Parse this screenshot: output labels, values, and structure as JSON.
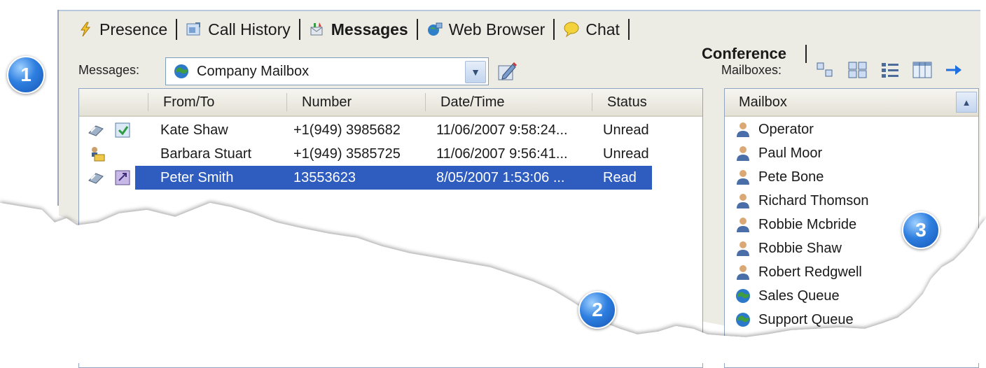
{
  "tabs": [
    {
      "label": "Presence",
      "icon": "lightning-icon"
    },
    {
      "label": "Call History",
      "icon": "call-history-icon"
    },
    {
      "label": "Messages",
      "icon": "messages-icon",
      "active": true
    },
    {
      "label": "Web Browser",
      "icon": "web-browser-icon"
    },
    {
      "label": "Chat",
      "icon": "chat-bubble-icon"
    }
  ],
  "conference_tab": "Conference",
  "messages_label": "Messages:",
  "mailbox_select": {
    "value": "Company Mailbox",
    "icon": "globe-icon"
  },
  "mailboxes_label": "Mailboxes:",
  "messages_table": {
    "columns": [
      "From/To",
      "Number",
      "Date/Time",
      "Status"
    ],
    "rows": [
      {
        "from_to": "Kate Shaw",
        "number": "+1(949) 3985682",
        "datetime": "11/06/2007 9:58:24...",
        "status": "Unread",
        "icons": [
          "voicemail-icon",
          "message-in-icon"
        ]
      },
      {
        "from_to": "Barbara Stuart",
        "number": "+1(949) 3585725",
        "datetime": "11/06/2007 9:56:41...",
        "status": "Unread",
        "icons": [
          "user-message-icon"
        ]
      },
      {
        "from_to": "Peter Smith",
        "number": "13553623",
        "datetime": "8/05/2007 1:53:06 ...",
        "status": "Read",
        "icons": [
          "voicemail-icon",
          "message-out-icon"
        ],
        "selected": true
      }
    ]
  },
  "mailbox_list": {
    "header": "Mailbox",
    "items": [
      {
        "label": "Operator",
        "icon": "person-icon"
      },
      {
        "label": "Paul Moor",
        "icon": "person-icon"
      },
      {
        "label": "Pete Bone",
        "icon": "person-icon"
      },
      {
        "label": "Richard Thomson",
        "icon": "person-icon"
      },
      {
        "label": "Robbie Mcbride",
        "icon": "person-icon"
      },
      {
        "label": "Robbie Shaw",
        "icon": "person-icon"
      },
      {
        "label": "Robert Redgwell",
        "icon": "person-icon"
      },
      {
        "label": "Sales Queue",
        "icon": "globe-icon"
      },
      {
        "label": "Support Queue",
        "icon": "globe-icon"
      }
    ]
  },
  "callouts": [
    "1",
    "2",
    "3"
  ],
  "colors": {
    "selection": "#2f5cbf",
    "panel": "#ecebe4",
    "badge": "#2e7fe0"
  }
}
